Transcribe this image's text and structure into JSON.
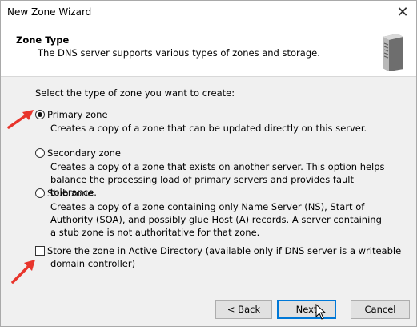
{
  "window": {
    "title": "New Zone Wizard"
  },
  "header": {
    "title": "Zone Type",
    "subtitle": "The DNS server supports various types of zones and storage."
  },
  "main": {
    "prompt": "Select the type of zone you want to create:",
    "options": [
      {
        "label": "Primary zone",
        "selected": true,
        "description": "Creates a copy of a zone that can be updated directly on this server."
      },
      {
        "label": "Secondary zone",
        "selected": false,
        "description": "Creates a copy of a zone that exists on another server. This option helps balance the processing load of primary servers and provides fault tolerance."
      },
      {
        "label": "Stub zone",
        "selected": false,
        "description": "Creates a copy of a zone containing only Name Server (NS), Start of Authority (SOA), and possibly glue Host (A) records. A server containing a stub zone is not authoritative for that zone."
      }
    ],
    "ad_checkbox": {
      "label": "Store the zone in Active Directory (available only if DNS server is a writeable domain controller)",
      "checked": false
    }
  },
  "footer": {
    "back_label": "< Back",
    "next_label": "Next",
    "cancel_label": "Cancel"
  },
  "colors": {
    "annotation_arrow": "#e8352c",
    "focus_border": "#0078d7"
  }
}
